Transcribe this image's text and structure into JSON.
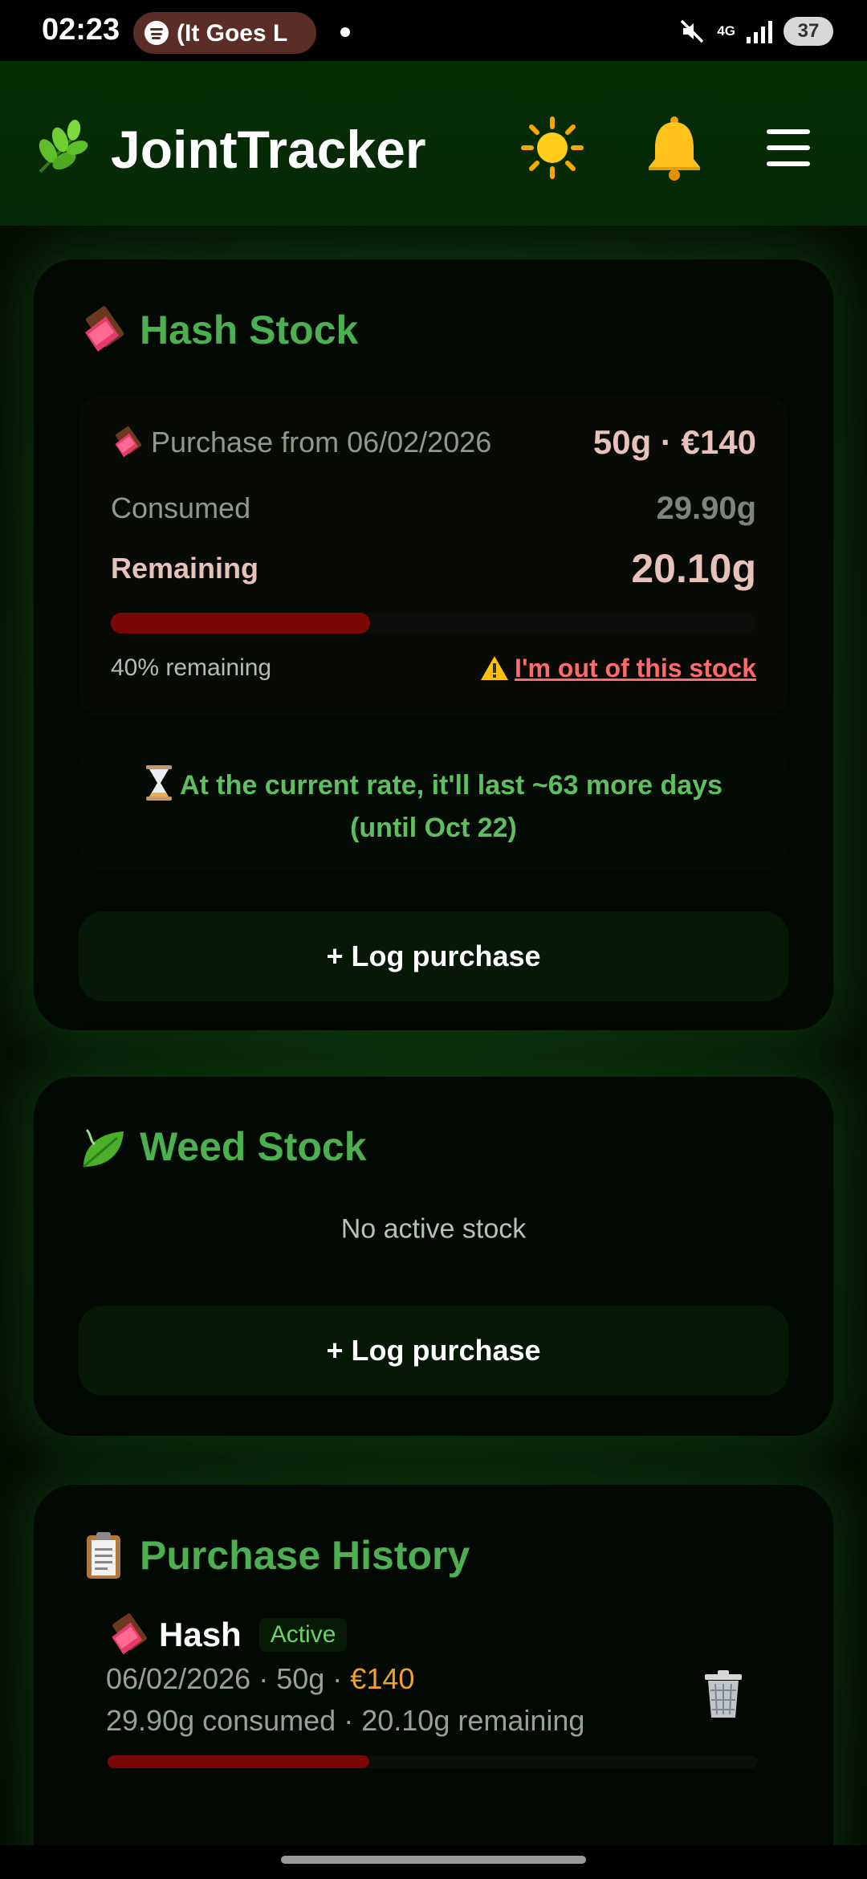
{
  "status_bar": {
    "time": "02:23",
    "media_text": "(It Goes L",
    "network": "4G",
    "battery": "37"
  },
  "header": {
    "app_title": "JointTracker",
    "logo_icon": "herb-icon",
    "theme_icon": "sun-icon",
    "notifications_icon": "bell-icon",
    "menu_icon": "hamburger-menu-icon"
  },
  "hash_stock": {
    "title": "Hash Stock",
    "icon": "chocolate-bar-icon",
    "purchase_label": "Purchase from 06/02/2026",
    "purchase_amount": "50g · €140",
    "consumed_label": "Consumed",
    "consumed_value": "29.90g",
    "remaining_label": "Remaining",
    "remaining_value": "20.10g",
    "remaining_fraction": 0.402,
    "remaining_percent_text": "40% remaining",
    "out_of_stock_link": "I'm out of this stock",
    "rate_text": "At the current rate, it'll last ~63 more days (until Oct 22)",
    "log_button": "+ Log purchase"
  },
  "weed_stock": {
    "title": "Weed Stock",
    "icon": "leaf-icon",
    "empty_text": "No active stock",
    "log_button": "+ Log purchase"
  },
  "history": {
    "title": "Purchase History",
    "icon": "clipboard-icon",
    "items": [
      {
        "type": "Hash",
        "status": "Active",
        "date": "06/02/2026",
        "amount": "50g",
        "price": "€140",
        "consumed_text": "29.90g consumed",
        "remaining_text": "20.10g remaining",
        "remaining_fraction": 0.402
      }
    ]
  },
  "colors": {
    "accent_green": "#4caf50",
    "bar_red": "#7a0606",
    "price_orange": "#f0a030",
    "link_red": "#ff6b6b"
  }
}
